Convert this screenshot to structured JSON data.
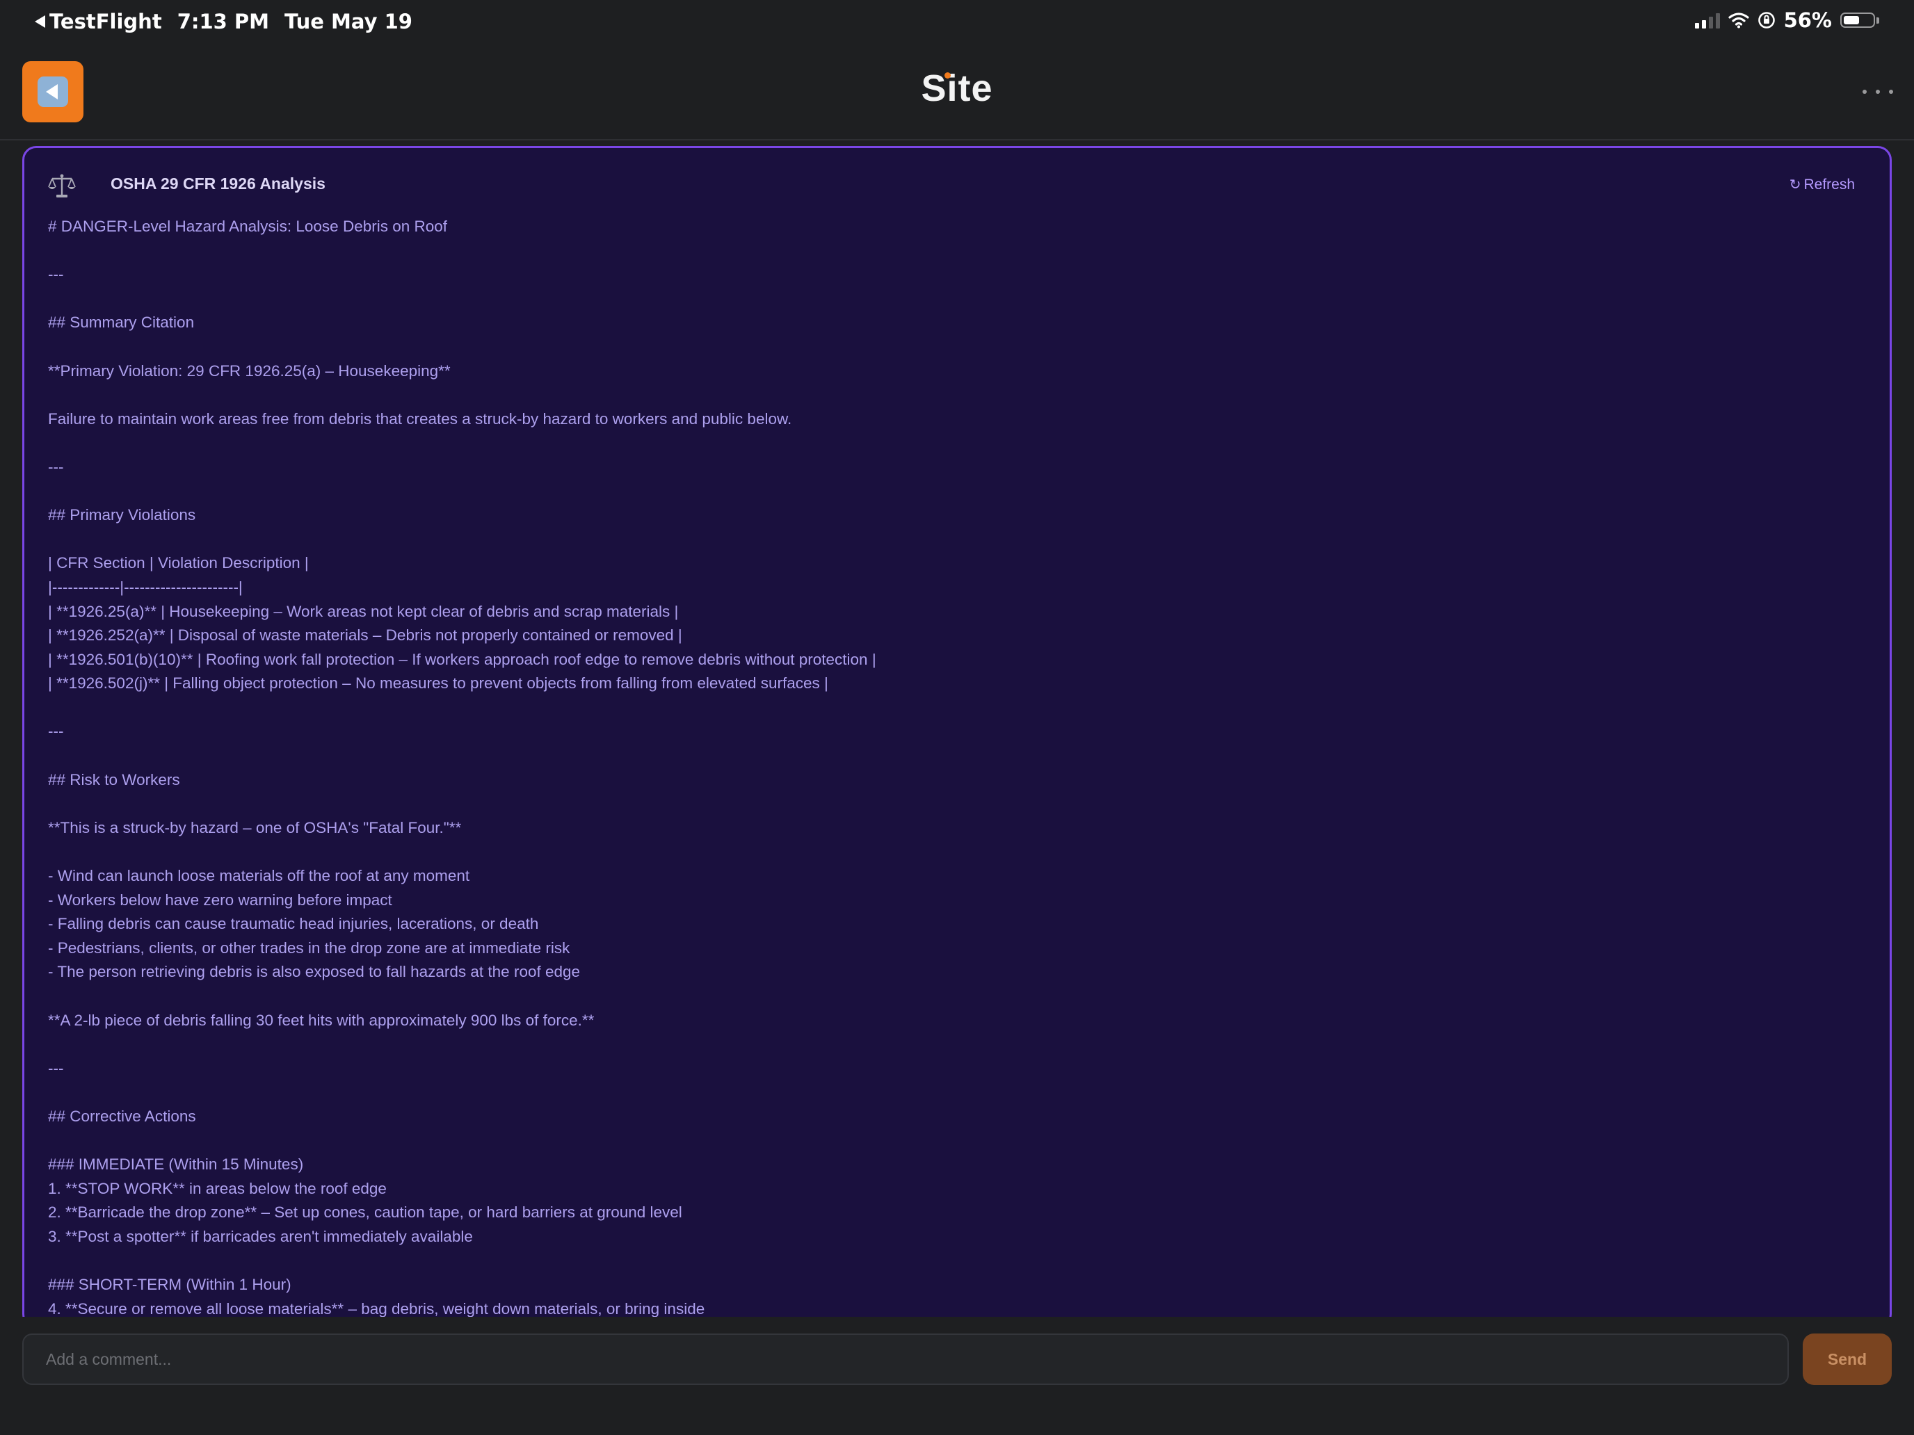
{
  "status_bar": {
    "back_app": "TestFlight",
    "time": "7:13 PM",
    "date": "Tue May 19",
    "battery": "56%",
    "battery_level": 0.56
  },
  "header": {
    "title": "Site",
    "back_icon": "back-arrow-icon",
    "more_icon": "ellipsis-icon",
    "accent_color": "#f07a1c"
  },
  "analysis_panel": {
    "icon": "scale-icon",
    "title": "OSHA 29 CFR 1926 Analysis",
    "refresh_label": "Refresh",
    "refresh_icon": "↻",
    "border_color": "#7a46e6",
    "lines": [
      "# DANGER-Level Hazard Analysis: Loose Debris on Roof",
      "",
      "---",
      "",
      "## Summary Citation",
      "",
      "**Primary Violation: 29 CFR 1926.25(a) – Housekeeping**",
      "",
      "Failure to maintain work areas free from debris that creates a struck-by hazard to workers and public below.",
      "",
      "---",
      "",
      "## Primary Violations",
      "",
      "| CFR Section | Violation Description |",
      "|-------------|----------------------|",
      "| **1926.25(a)** | Housekeeping – Work areas not kept clear of debris and scrap materials |",
      "| **1926.252(a)** | Disposal of waste materials – Debris not properly contained or removed |",
      "| **1926.501(b)(10)** | Roofing work fall protection – If workers approach roof edge to remove debris without protection |",
      "| **1926.502(j)** | Falling object protection – No measures to prevent objects from falling from elevated surfaces |",
      "",
      "---",
      "",
      "## Risk to Workers",
      "",
      "**This is a struck-by hazard – one of OSHA's \"Fatal Four.\"**",
      "",
      "- Wind can launch loose materials off the roof at any moment",
      "- Workers below have zero warning before impact",
      "- Falling debris can cause traumatic head injuries, lacerations, or death",
      "- Pedestrians, clients, or other trades in the drop zone are at immediate risk",
      "- The person retrieving debris is also exposed to fall hazards at the roof edge",
      "",
      "**A 2-lb piece of debris falling 30 feet hits with approximately 900 lbs of force.**",
      "",
      "---",
      "",
      "## Corrective Actions",
      "",
      "### IMMEDIATE (Within 15 Minutes)",
      "1. **STOP WORK** in areas below the roof edge",
      "2. **Barricade the drop zone** – Set up cones, caution tape, or hard barriers at ground level",
      "3. **Post a spotter** if barricades aren't immediately available",
      "",
      "### SHORT-TERM (Within 1 Hour)",
      "4. **Secure or remove all loose materials** – bag debris, weight down materials, or bring inside"
    ]
  },
  "comment_bar": {
    "placeholder": "Add a comment...",
    "value": "",
    "send_label": "Send"
  }
}
